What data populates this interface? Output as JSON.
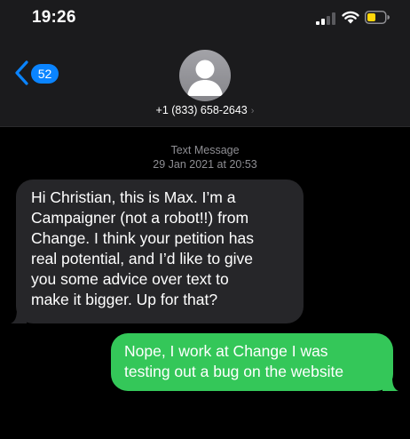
{
  "status_bar": {
    "time": "19:26"
  },
  "nav": {
    "back_count": "52"
  },
  "contact": {
    "name": "+1 (833) 658-2643",
    "chevron": "›"
  },
  "conversation": {
    "service": "Text Message",
    "timestamp": "29 Jan 2021 at 20:53"
  },
  "messages": [
    {
      "direction": "incoming",
      "lines": [
        " Hi Christian, this is Max. I’m a",
        "Campaigner (not a robot!!) from",
        "Change. I think your petition has",
        "real potential, and I’d like to give",
        "you some advice over text to",
        "make it bigger. Up for that?"
      ]
    },
    {
      "direction": "outgoing",
      "lines": [
        "Nope, I work at Change I was",
        "testing out a bug on the website"
      ]
    }
  ],
  "colors": {
    "header_bg": "#1b1b1d",
    "incoming_bubble": "#262629",
    "outgoing_bubble": "#34c759",
    "badge": "#0a84ff",
    "battery_low": "#ffd60a"
  },
  "icons": {
    "signal": "signal-strength-icon",
    "wifi": "wifi-icon",
    "battery": "battery-icon",
    "back": "chevron-left-icon",
    "avatar": "person-silhouette-icon"
  }
}
